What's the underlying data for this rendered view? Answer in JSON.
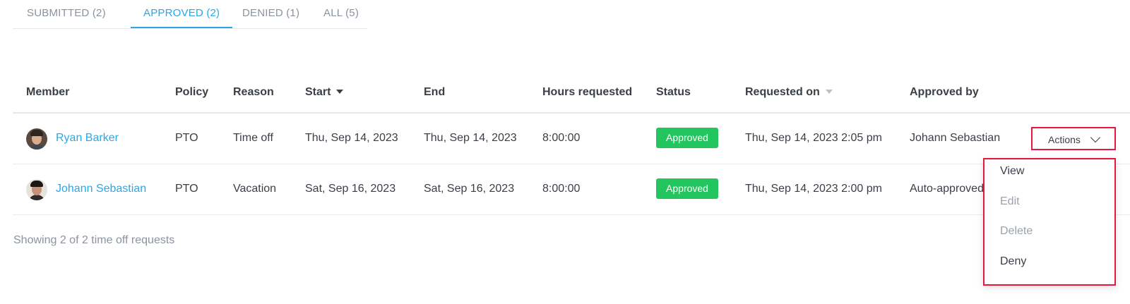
{
  "tabs": [
    {
      "label": "SUBMITTED (2)"
    },
    {
      "label": "APPROVED (2)"
    },
    {
      "label": "DENIED (1)"
    },
    {
      "label": "ALL (5)"
    }
  ],
  "table": {
    "headers": {
      "member": "Member",
      "policy": "Policy",
      "reason": "Reason",
      "start": "Start",
      "end": "End",
      "hours": "Hours requested",
      "status": "Status",
      "requested_on": "Requested on",
      "approved_by": "Approved by"
    },
    "rows": [
      {
        "member": "Ryan Barker",
        "policy": "PTO",
        "reason": "Time off",
        "start": "Thu, Sep 14, 2023",
        "end": "Thu, Sep 14, 2023",
        "hours": "8:00:00",
        "status": "Approved",
        "requested_on": "Thu, Sep 14, 2023 2:05 pm",
        "approved_by": "Johann Sebastian"
      },
      {
        "member": "Johann Sebastian",
        "policy": "PTO",
        "reason": "Vacation",
        "start": "Sat, Sep 16, 2023",
        "end": "Sat, Sep 16, 2023",
        "hours": "8:00:00",
        "status": "Approved",
        "requested_on": "Thu, Sep 14, 2023 2:00 pm",
        "approved_by": "Auto-approved"
      }
    ]
  },
  "actions": {
    "button_label": "Actions",
    "menu": [
      "View",
      "Edit",
      "Delete",
      "Deny"
    ]
  },
  "footer": "Showing 2 of 2 time off requests",
  "colors": {
    "accent": "#2aa7e6",
    "approved": "#22c55e",
    "highlight": "#e8183c"
  }
}
